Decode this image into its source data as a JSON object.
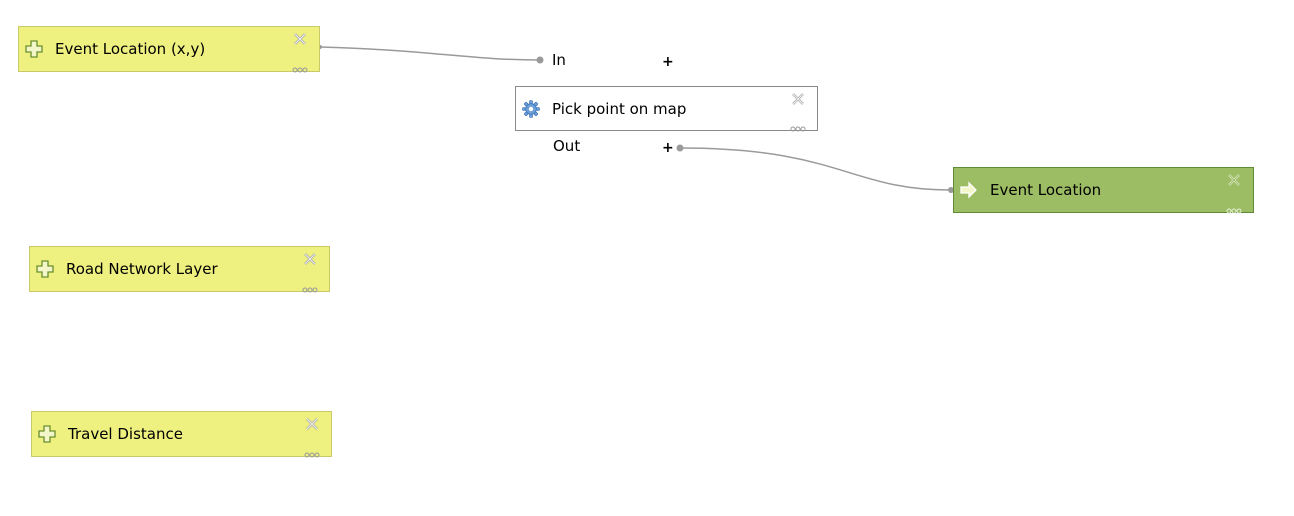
{
  "nodes": {
    "input_event_location": {
      "label": "Event Location (x,y)",
      "icon": "plus-cross-icon"
    },
    "input_road_network": {
      "label": "Road Network Layer",
      "icon": "plus-cross-icon"
    },
    "input_travel_distance": {
      "label": "Travel Distance",
      "icon": "plus-cross-icon"
    },
    "algorithm_pick_point": {
      "label": "Pick point on map",
      "icon": "gear-icon",
      "in_label": "In",
      "out_label": "Out",
      "in_plus": "+",
      "out_plus": "+"
    },
    "output_event_location": {
      "label": "Event Location",
      "icon": "arrow-right-icon"
    }
  },
  "colors": {
    "input_fill": "#eef080",
    "output_fill": "#9cbd63",
    "algo_fill": "#ffffff",
    "wire": "#9a9a9a"
  }
}
